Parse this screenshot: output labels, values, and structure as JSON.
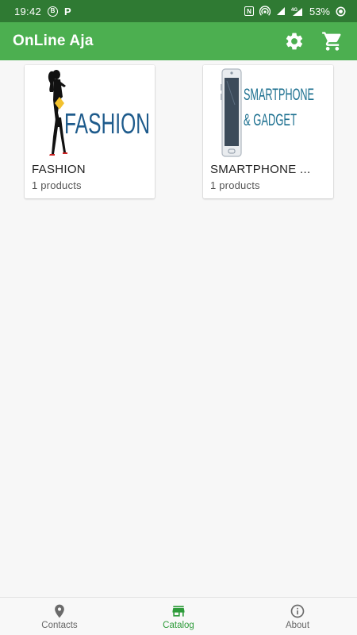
{
  "status_bar": {
    "time": "19:42",
    "notif_b": "B",
    "notif_p": "P",
    "nfc": "N",
    "network": "4G",
    "battery": "53%"
  },
  "app_bar": {
    "title": "OnLine Aja"
  },
  "categories": [
    {
      "name": "FASHION",
      "count": "1 products",
      "image_text": "FASHION"
    },
    {
      "name": "SMARTPHONE ...",
      "count": "1 products",
      "image_text_1": "SMARTPHONE",
      "image_text_2": "& GADGET"
    }
  ],
  "bottom_nav": {
    "items": [
      {
        "label": "Contacts",
        "icon": "location-pin-icon"
      },
      {
        "label": "Catalog",
        "icon": "store-icon",
        "active": true
      },
      {
        "label": "About",
        "icon": "info-icon"
      }
    ]
  },
  "colors": {
    "status_bar": "#2f7a33",
    "app_bar": "#4caf50",
    "active_nav": "#2e9b3a",
    "fashion_text": "#1e5b8c",
    "gadget_text": "#1b6f8f"
  }
}
